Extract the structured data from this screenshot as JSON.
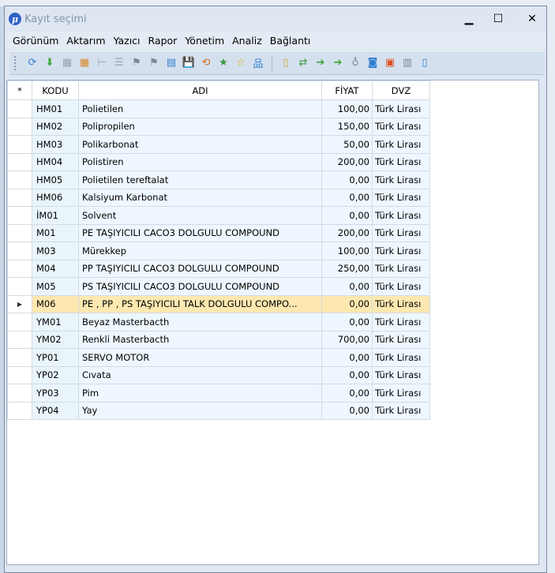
{
  "window": {
    "title": "Kayıt seçimi",
    "icon": "app-logo-icon"
  },
  "controls": {
    "minimize": "▁",
    "maximize": "☐",
    "close": "✕"
  },
  "menu": [
    "Görünüm",
    "Aktarım",
    "Yazıcı",
    "Rapor",
    "Yönetim",
    "Analiz",
    "Bağlantı"
  ],
  "toolbar": [
    {
      "name": "refresh-icon",
      "glyph": "⟳",
      "color": "#2f7fd0"
    },
    {
      "name": "add-record-icon",
      "glyph": "⬇",
      "color": "#3da534"
    },
    {
      "name": "grid-view-icon",
      "glyph": "▦",
      "color": "#9aa4b0"
    },
    {
      "name": "table-icon",
      "glyph": "▦",
      "color": "#d88a2a"
    },
    {
      "name": "tree-icon",
      "glyph": "⊢",
      "color": "#9aa4b0"
    },
    {
      "name": "list-icon",
      "glyph": "☰",
      "color": "#9aa4b0"
    },
    {
      "name": "flag-icon",
      "glyph": "⚑",
      "color": "#7a8898"
    },
    {
      "name": "flag-right-icon",
      "glyph": "⚑",
      "color": "#7a8898"
    },
    {
      "name": "export-icon",
      "glyph": "▤",
      "color": "#2f7fd0"
    },
    {
      "name": "save-icon",
      "glyph": "💾",
      "color": "#2f4fa8"
    },
    {
      "name": "sync-icon",
      "glyph": "⟲",
      "color": "#d06a1a"
    },
    {
      "name": "favorite-add-icon",
      "glyph": "★",
      "color": "#3a9a3a"
    },
    {
      "name": "favorite-icon",
      "glyph": "☆",
      "color": "#e0a800"
    },
    {
      "name": "network-icon",
      "glyph": "品",
      "color": "#2f7fd0"
    },
    {
      "name": "separator",
      "glyph": "",
      "color": ""
    },
    {
      "name": "document-icon",
      "glyph": "▯",
      "color": "#d0a030"
    },
    {
      "name": "transfer-icon",
      "glyph": "⇄",
      "color": "#3a9a3a"
    },
    {
      "name": "arrow-right-icon",
      "glyph": "➔",
      "color": "#3da534"
    },
    {
      "name": "arrow-right-alt-icon",
      "glyph": "➔",
      "color": "#3da534"
    },
    {
      "name": "stethoscope-icon",
      "glyph": "♁",
      "color": "#7a8898"
    },
    {
      "name": "preview-icon",
      "glyph": "◙",
      "color": "#2f7fd0"
    },
    {
      "name": "calendar-icon",
      "glyph": "▣",
      "color": "#e05020"
    },
    {
      "name": "columns-icon",
      "glyph": "▥",
      "color": "#7a8898"
    },
    {
      "name": "page-icon",
      "glyph": "▯",
      "color": "#2f7fd0"
    }
  ],
  "grid": {
    "headers": {
      "indicator": "*",
      "kodu": "KODU",
      "adi": "ADI",
      "fiyat": "FİYAT",
      "dvz": "DVZ"
    },
    "rows": [
      {
        "kodu": "HM01",
        "adi": "Polietilen",
        "fiyat": "100,00",
        "dvz": "Türk Lirası",
        "sel": false
      },
      {
        "kodu": "HM02",
        "adi": "Polipropilen",
        "fiyat": "150,00",
        "dvz": "Türk Lirası",
        "sel": false
      },
      {
        "kodu": "HM03",
        "adi": "Polikarbonat",
        "fiyat": "50,00",
        "dvz": "Türk Lirası",
        "sel": false
      },
      {
        "kodu": "HM04",
        "adi": "Polistiren",
        "fiyat": "200,00",
        "dvz": "Türk Lirası",
        "sel": false
      },
      {
        "kodu": "HM05",
        "adi": "Polietilen tereftalat",
        "fiyat": "0,00",
        "dvz": "Türk Lirası",
        "sel": false
      },
      {
        "kodu": "HM06",
        "adi": "Kalsiyum Karbonat",
        "fiyat": "0,00",
        "dvz": "Türk Lirası",
        "sel": false
      },
      {
        "kodu": "İM01",
        "adi": "Solvent",
        "fiyat": "0,00",
        "dvz": "Türk Lirası",
        "sel": false
      },
      {
        "kodu": "M01",
        "adi": "PE TAŞIYICILI CACO3 DOLGULU COMPOUND",
        "fiyat": "200,00",
        "dvz": "Türk Lirası",
        "sel": false
      },
      {
        "kodu": "M03",
        "adi": "Mürekkep",
        "fiyat": "100,00",
        "dvz": "Türk Lirası",
        "sel": false
      },
      {
        "kodu": "M04",
        "adi": "PP TAŞIYICILI CACO3 DOLGULU COMPOUND",
        "fiyat": "250,00",
        "dvz": "Türk Lirası",
        "sel": false
      },
      {
        "kodu": "M05",
        "adi": "PS TAŞIYICILI CACO3 DOLGULU COMPOUND",
        "fiyat": "0,00",
        "dvz": "Türk Lirası",
        "sel": false
      },
      {
        "kodu": "M06",
        "adi": "PE , PP , PS TAŞIYICILI TALK DOLGULU COMPO...",
        "fiyat": "0,00",
        "dvz": "Türk Lirası",
        "sel": true
      },
      {
        "kodu": "YM01",
        "adi": "Beyaz Masterbacth",
        "fiyat": "0,00",
        "dvz": "Türk Lirası",
        "sel": false
      },
      {
        "kodu": "YM02",
        "adi": "Renkli Masterbacth",
        "fiyat": "700,00",
        "dvz": "Türk Lirası",
        "sel": false
      },
      {
        "kodu": "YP01",
        "adi": "SERVO MOTOR",
        "fiyat": "0,00",
        "dvz": "Türk Lirası",
        "sel": false
      },
      {
        "kodu": "YP02",
        "adi": "Cıvata",
        "fiyat": "0,00",
        "dvz": "Türk Lirası",
        "sel": false
      },
      {
        "kodu": "YP03",
        "adi": "Pim",
        "fiyat": "0,00",
        "dvz": "Türk Lirası",
        "sel": false
      },
      {
        "kodu": "YP04",
        "adi": "Yay",
        "fiyat": "0,00",
        "dvz": "Türk Lirası",
        "sel": false
      }
    ],
    "current_row_marker": "▶"
  }
}
